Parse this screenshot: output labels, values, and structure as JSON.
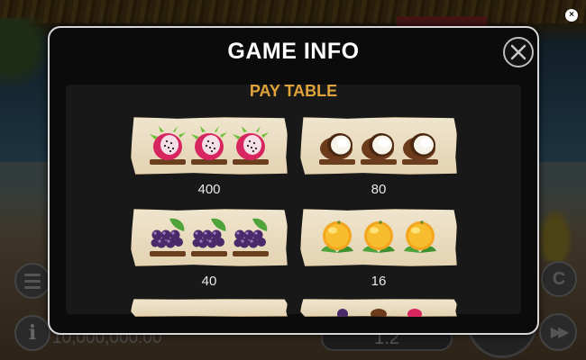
{
  "background": {
    "balance": "10,000,000.00",
    "bet": "1.2",
    "info_label": "i"
  },
  "modal": {
    "title": "GAME INFO",
    "section_title": "PAY TABLE",
    "paytable": [
      {
        "symbol": "dragonfruit",
        "count": 3,
        "payout": "400"
      },
      {
        "symbol": "coconut",
        "count": 3,
        "payout": "80"
      },
      {
        "symbol": "grapes",
        "count": 3,
        "payout": "40"
      },
      {
        "symbol": "orange",
        "count": 3,
        "payout": "16"
      }
    ]
  },
  "colors": {
    "section_title": "#e0a33a",
    "modal_bg": "#0b0b0b",
    "card_bg": "#e9dcc0"
  },
  "icons": [
    "close-icon",
    "info-icon",
    "menu-icon",
    "fast-forward-icon",
    "autoplay-icon"
  ]
}
